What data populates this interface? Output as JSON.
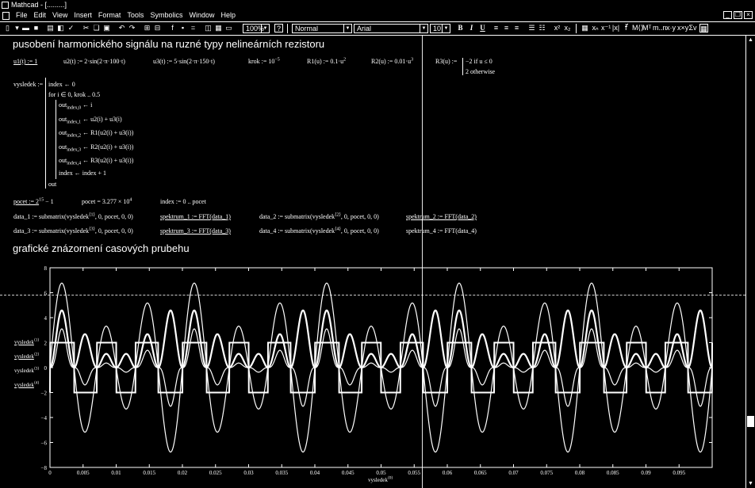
{
  "window": {
    "title": "Mathcad - [.........]"
  },
  "menu": [
    "File",
    "Edit",
    "View",
    "Insert",
    "Format",
    "Tools",
    "Symbolics",
    "Window",
    "Help"
  ],
  "toolbar": {
    "zoom": "100%",
    "style": "Normal",
    "font": "Arial",
    "size": "10",
    "bold": "B",
    "italic": "I",
    "underline": "U"
  },
  "headings": {
    "h1": "pusobení harmonického signálu na ruzné typy nelineárních rezistoru",
    "h2": "grafické znázornení casových prubehu"
  },
  "defs": {
    "u1": "u1(t) := 1",
    "u2": "u2(t) := 2·sin(2·π·100·t)",
    "u3": "u3(t) := 5·sin(2·π·150·t)",
    "krok": "krok := 10",
    "krok_exp": "−5",
    "R1": "R1(u) := 0.1·u",
    "R1_exp": "2",
    "R2": "R2(u) := 0.01·u",
    "R2_exp": "3",
    "R3_label": "R3(u) :=",
    "R3_case1": "−2  if  u ≤ 0",
    "R3_case2": "2   otherwise"
  },
  "program": {
    "label": "vysledek :=",
    "l1": "index ← 0",
    "l2": "for  i ∈ 0, krok .. 0.5",
    "l3": "out",
    "l3s": "index,0",
    "l3r": " ← i",
    "l4s": "index,1",
    "l4r": " ← u2(i) + u3(i)",
    "l5s": "index,2",
    "l5r": " ← R1(u2(i) + u3(i))",
    "l6s": "index,3",
    "l6r": " ← R2(u2(i) + u3(i))",
    "l7s": "index,4",
    "l7r": " ← R3(u2(i) + u3(i))",
    "l8": "index ← index + 1",
    "l9": "out"
  },
  "calc": {
    "pocet_def": "pocet := 2",
    "pocet_def_exp": "15",
    "pocet_def_tail": " − 1",
    "pocet_val": "pocet = 3.277 × 10",
    "pocet_val_exp": "4",
    "index_range": "index := 0 .. pocet"
  },
  "submatrix": {
    "d1": "data_1 := submatrix(vysledek",
    "d1s": "⟨1⟩",
    "d1t": ", 0, pocet, 0, 0)",
    "s1": "spektrum_1 := FFT(data_1)",
    "d2": "data_2 := submatrix(vysledek",
    "d2s": "⟨2⟩",
    "d2t": ", 0, pocet, 0, 0)",
    "s2": "spektrum_2 := FFT(data_2)",
    "d3": "data_3 := submatrix(vysledek",
    "d3s": "⟨3⟩",
    "d3t": ", 0, pocet, 0, 0)",
    "s3": "spektrum_3 := FFT(data_3)",
    "d4": "data_4 := submatrix(vysledek",
    "d4s": "⟨4⟩",
    "d4t": ", 0, pocet, 0, 0)",
    "s4": "spektrum_4 := FFT(data_4)"
  },
  "legend": {
    "base": "vysledek",
    "s1": "⟨1⟩",
    "s2": "⟨2⟩",
    "s3": "⟨3⟩",
    "s4": "⟨4⟩",
    "x": "⟨0⟩"
  },
  "chart_data": {
    "type": "line",
    "xlim": [
      0,
      0.1
    ],
    "ylim": [
      -8,
      8
    ],
    "xticks": [
      "0",
      "0.005",
      "0.01",
      "0.015",
      "0.02",
      "0.025",
      "0.03",
      "0.035",
      "0.04",
      "0.045",
      "0.05",
      "0.055",
      "0.06",
      "0.065",
      "0.07",
      "0.075",
      "0.08",
      "0.085",
      "0.09",
      "0.095"
    ],
    "yticks": [
      "8",
      "6",
      "4",
      "2",
      "0",
      "−2",
      "−4",
      "−6",
      "−8"
    ],
    "series": [
      {
        "name": "vysledek⟨1⟩",
        "formula": "2·sin(2π·100·t) + 5·sin(2π·150·t)",
        "amplitude_max": 6.8,
        "amplitude_min": -6.8
      },
      {
        "name": "vysledek⟨2⟩",
        "formula": "0.1·u²",
        "amplitude_max": 4.6,
        "amplitude_min": 0
      },
      {
        "name": "vysledek⟨3⟩",
        "formula": "0.01·u³",
        "amplitude_max": 3.1,
        "amplitude_min": -3.1
      },
      {
        "name": "vysledek⟨4⟩",
        "formula": "±2 (sign)",
        "amplitude_max": 2,
        "amplitude_min": -2
      }
    ],
    "grid": false
  }
}
